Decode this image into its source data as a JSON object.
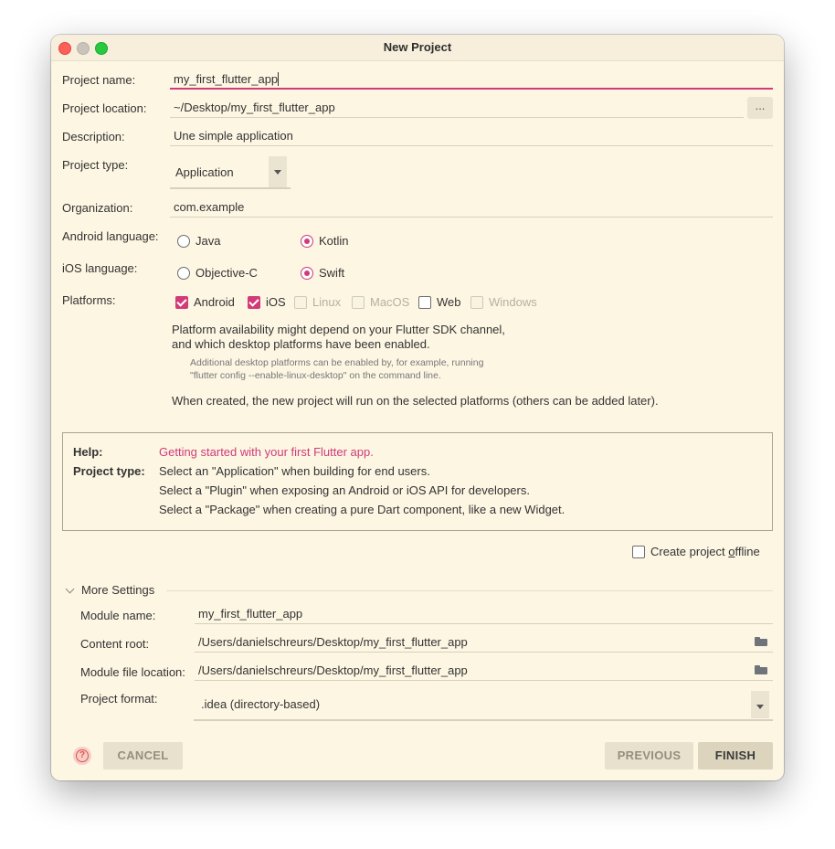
{
  "window": {
    "title": "New Project"
  },
  "form": {
    "project_name_label": "Project name:",
    "project_name_value": "my_first_flutter_app",
    "project_location_label": "Project location:",
    "project_location_value": "~/Desktop/my_first_flutter_app",
    "browse_button": "...",
    "description_label": "Description:",
    "description_value": "Une simple application",
    "project_type_label": "Project type:",
    "project_type_value": "Application",
    "organization_label": "Organization:",
    "organization_value": "com.example",
    "android_language_label": "Android language:",
    "android_options": [
      {
        "label": "Java",
        "selected": false
      },
      {
        "label": "Kotlin",
        "selected": true
      }
    ],
    "ios_language_label": "iOS language:",
    "ios_options": [
      {
        "label": "Objective-C",
        "selected": false
      },
      {
        "label": "Swift",
        "selected": true
      }
    ],
    "platforms_label": "Platforms:",
    "platforms": [
      {
        "label": "Android",
        "checked": true,
        "enabled": true
      },
      {
        "label": "iOS",
        "checked": true,
        "enabled": true
      },
      {
        "label": "Linux",
        "checked": false,
        "enabled": false
      },
      {
        "label": "MacOS",
        "checked": false,
        "enabled": false
      },
      {
        "label": "Web",
        "checked": false,
        "enabled": true
      },
      {
        "label": "Windows",
        "checked": false,
        "enabled": false
      }
    ],
    "platform_note_line1": "Platform availability might depend on your Flutter SDK channel,",
    "platform_note_line2": "and which desktop platforms have been enabled.",
    "platform_small_line1": "Additional desktop platforms can be enabled by, for example, running",
    "platform_small_line2": "\"flutter config --enable-linux-desktop\" on the command line.",
    "platform_created_note": "When created, the new project will run on the selected platforms (others can be added later)."
  },
  "help": {
    "help_label": "Help:",
    "help_link": "Getting started with your first Flutter app.",
    "type_label": "Project type:",
    "lines": [
      "Select an \"Application\" when building for end users.",
      "Select a \"Plugin\" when exposing an Android or iOS API for developers.",
      "Select a \"Package\" when creating a pure Dart component, like a new Widget."
    ]
  },
  "offline": {
    "label_pre": "Create project ",
    "label_u": "o",
    "label_post": "ffline",
    "checked": false
  },
  "more_settings": {
    "title": "More Settings",
    "module_name_label": "Module name:",
    "module_name_value": "my_first_flutter_app",
    "content_root_label": "Content root:",
    "content_root_value": "/Users/danielschreurs/Desktop/my_first_flutter_app",
    "module_file_label": "Module file location:",
    "module_file_value": "/Users/danielschreurs/Desktop/my_first_flutter_app",
    "project_format_label": "Project format:",
    "project_format_value": ".idea (directory-based)"
  },
  "buttons": {
    "help": "?",
    "cancel": "CANCEL",
    "previous": "PREVIOUS",
    "finish": "FINISH"
  },
  "colors": {
    "accent": "#d03b78",
    "background": "#fdf6e3"
  }
}
